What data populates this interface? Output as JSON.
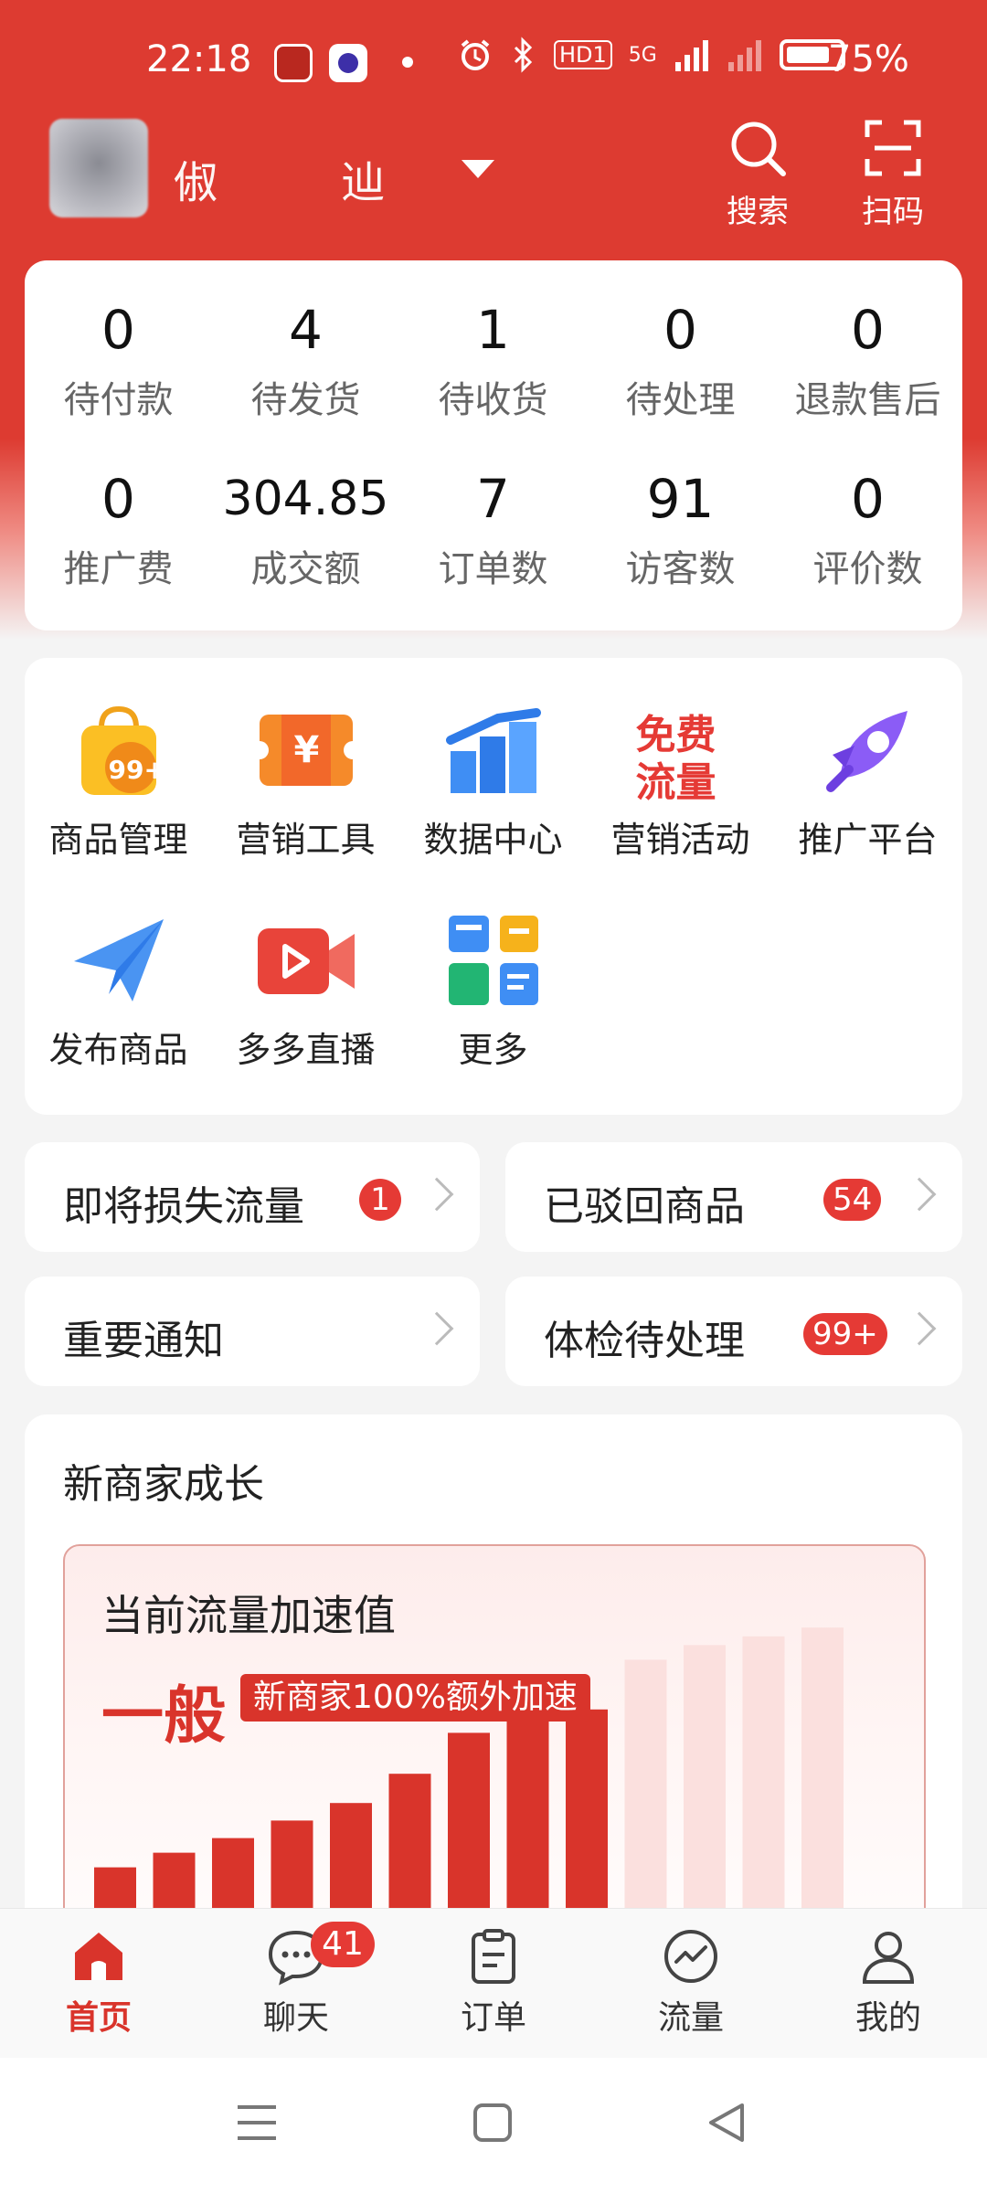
{
  "status_bar": {
    "time": "22:18",
    "hd_label": "HD1",
    "network_label": "5G",
    "battery_text": "75%"
  },
  "header": {
    "shop_name": "俶 辿",
    "search_label": "搜索",
    "scan_label": "扫码"
  },
  "stats": [
    {
      "value": "0",
      "label": "待付款"
    },
    {
      "value": "4",
      "label": "待发货"
    },
    {
      "value": "1",
      "label": "待收货"
    },
    {
      "value": "0",
      "label": "待处理"
    },
    {
      "value": "0",
      "label": "退款售后"
    },
    {
      "value": "0",
      "label": "推广费"
    },
    {
      "value": "304.85",
      "label": "成交额"
    },
    {
      "value": "7",
      "label": "订单数"
    },
    {
      "value": "91",
      "label": "访客数"
    },
    {
      "value": "0",
      "label": "评价数"
    }
  ],
  "tools": [
    {
      "label": "商品管理",
      "icon": "shopping-bag-icon",
      "icon_text": "99+"
    },
    {
      "label": "营销工具",
      "icon": "coupon-icon",
      "icon_text": "¥"
    },
    {
      "label": "数据中心",
      "icon": "bar-chart-icon"
    },
    {
      "label": "营销活动",
      "icon": "free-traffic-icon",
      "icon_text_1": "免费",
      "icon_text_2": "流量"
    },
    {
      "label": "推广平台",
      "icon": "rocket-icon"
    },
    {
      "label": "发布商品",
      "icon": "paper-plane-icon"
    },
    {
      "label": "多多直播",
      "icon": "live-video-icon"
    },
    {
      "label": "更多",
      "icon": "more-apps-icon"
    }
  ],
  "quick_entries": [
    {
      "title": "即将损失流量",
      "badge": "1"
    },
    {
      "title": "已驳回商品",
      "badge": "54"
    },
    {
      "title": "重要通知",
      "badge": ""
    },
    {
      "title": "体检待处理",
      "badge": "99+"
    }
  ],
  "growth": {
    "title": "新商家成长",
    "accel_label": "当前流量加速值",
    "accel_value": "一般",
    "accel_tag": "新商家100%额外加速",
    "bars": [
      0.12,
      0.17,
      0.22,
      0.28,
      0.34,
      0.44,
      0.58,
      0.69,
      0.66,
      0.83,
      0.88,
      0.91,
      0.94
    ],
    "bar_color": "#d9342b",
    "bar_faded_color": "#fbe0de"
  },
  "bottom_nav": [
    {
      "label": "首页",
      "icon": "home-icon",
      "active": true
    },
    {
      "label": "聊天",
      "icon": "chat-icon",
      "badge": "41"
    },
    {
      "label": "订单",
      "icon": "order-icon"
    },
    {
      "label": "流量",
      "icon": "traffic-icon"
    },
    {
      "label": "我的",
      "icon": "profile-icon"
    }
  ],
  "colors": {
    "brand_red": "#dd3b31",
    "badge_red": "#e53a35"
  }
}
